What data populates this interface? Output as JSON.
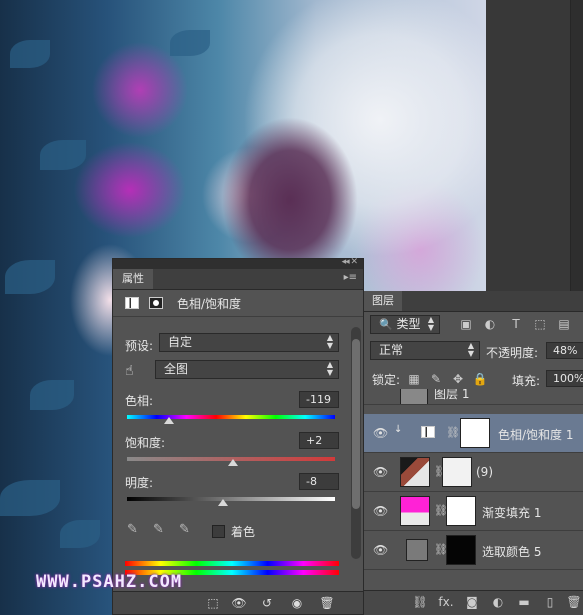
{
  "properties": {
    "tab": "属性",
    "title": "色相/饱和度",
    "preset_label": "预设:",
    "preset_value": "自定",
    "channel_value": "全图",
    "hue": {
      "label": "色相:",
      "value": "-119",
      "fraction": 0.2
    },
    "saturation": {
      "label": "饱和度:",
      "value": "+2",
      "fraction": 0.51
    },
    "lightness": {
      "label": "明度:",
      "value": "-8",
      "fraction": 0.46
    },
    "colorize_label": "着色"
  },
  "layers": {
    "tab": "图层",
    "filter_type": "类型",
    "blend_mode": "正常",
    "opacity_label": "不透明度:",
    "opacity_value": "48%",
    "lock_label": "锁定:",
    "fill_label": "填充:",
    "fill_value": "100%",
    "items": [
      {
        "name": "图层 1"
      },
      {
        "name": "色相/饱和度 1"
      },
      {
        "name": "(9)"
      },
      {
        "name": "渐变填充 1"
      },
      {
        "name": "选取颜色 5"
      }
    ],
    "footer_fx": "fx."
  },
  "watermark": "WWW.PSAHZ.COM"
}
